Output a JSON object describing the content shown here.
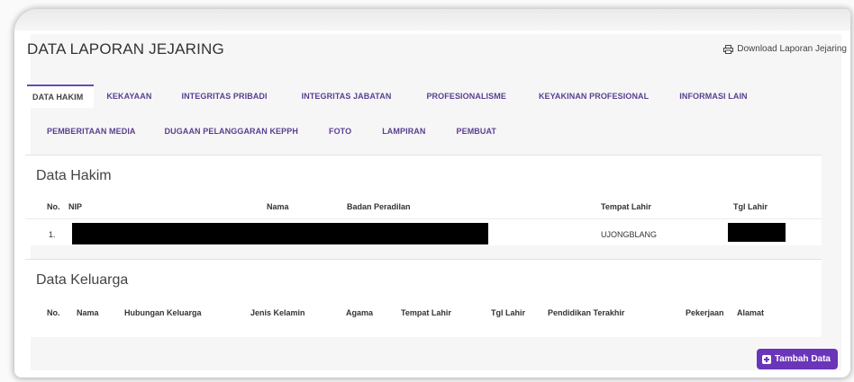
{
  "page": {
    "title": "DATA LAPORAN JEJARING",
    "download_label": "Download Laporan Jejaring",
    "download_icon": "printer-icon"
  },
  "tabs_row1": [
    "DATA HAKIM",
    "KEKAYAAN",
    "INTEGRITAS PRIBADI",
    "INTEGRITAS JABATAN",
    "PROFESIONALISME",
    "KEYAKINAN PROFESIONAL",
    "INFORMASI LAIN"
  ],
  "tabs_row2": [
    "PEMBERITAAN MEDIA",
    "DUGAAN PELANGGARAN KEPPH",
    "FOTO",
    "LAMPIRAN",
    "PEMBUAT"
  ],
  "active_tab": "DATA HAKIM",
  "hakim": {
    "title": "Data Hakim",
    "headers": [
      "No.",
      "NIP",
      "Nama",
      "Badan Peradilan",
      "Tempat Lahir",
      "Tgl Lahir"
    ],
    "rows": [
      {
        "no": "1.",
        "tempat_lahir": "UJONGBLANG"
      }
    ]
  },
  "keluarga": {
    "title": "Data Keluarga",
    "headers": [
      "No.",
      "Nama",
      "Hubungan Keluarga",
      "Jenis Kelamin",
      "Agama",
      "Tempat Lahir",
      "Tgl Lahir",
      "Pendidikan Terakhir",
      "Pekerjaan",
      "Alamat"
    ]
  },
  "add_button": {
    "label": "Tambah Data",
    "icon": "plus-square-icon"
  },
  "colors": {
    "accent": "#6a35b8",
    "tab_text": "#5a3f8f"
  }
}
